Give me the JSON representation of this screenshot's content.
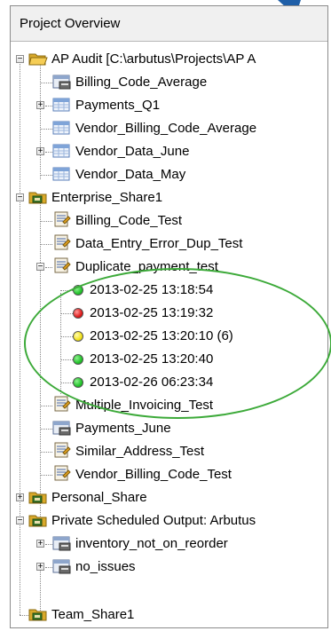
{
  "panel": {
    "title": "Project Overview"
  },
  "tree": [
    {
      "label": "AP Audit [C:\\arbutus\\Projects\\AP A",
      "icon": "folder-open-icon",
      "expander": "-"
    },
    {
      "label": "Billing_Code_Average",
      "icon": "table-layout-icon",
      "expander": ""
    },
    {
      "label": "Payments_Q1",
      "icon": "table-icon",
      "expander": "+"
    },
    {
      "label": "Vendor_Billing_Code_Average",
      "icon": "table-icon",
      "expander": ""
    },
    {
      "label": "Vendor_Data_June",
      "icon": "table-icon",
      "expander": "+"
    },
    {
      "label": "Vendor_Data_May",
      "icon": "table-icon",
      "expander": ""
    },
    {
      "label": "Enterprise_Share1",
      "icon": "share-folder-icon",
      "expander": "-"
    },
    {
      "label": "Billing_Code_Test",
      "icon": "script-icon",
      "expander": ""
    },
    {
      "label": "Data_Entry_Error_Dup_Test",
      "icon": "script-icon",
      "expander": ""
    },
    {
      "label": "Duplicate_payment_test",
      "icon": "script-icon",
      "expander": "-"
    },
    {
      "label": "2013-02-25 13:18:54",
      "status": "green",
      "expander": ""
    },
    {
      "label": "2013-02-25 13:19:32",
      "status": "red",
      "expander": ""
    },
    {
      "label": "2013-02-25 13:20:10 (6)",
      "status": "yellow",
      "expander": ""
    },
    {
      "label": "2013-02-25 13:20:40",
      "status": "green",
      "expander": ""
    },
    {
      "label": "2013-02-26 06:23:34",
      "status": "green",
      "expander": ""
    },
    {
      "label": "Multiple_Invoicing_Test",
      "icon": "script-icon",
      "expander": ""
    },
    {
      "label": "Payments_June",
      "icon": "table-layout-icon",
      "expander": ""
    },
    {
      "label": "Similar_Address_Test",
      "icon": "script-icon",
      "expander": ""
    },
    {
      "label": "Vendor_Billing_Code_Test",
      "icon": "script-icon",
      "expander": ""
    },
    {
      "label": "Personal_Share",
      "icon": "share-folder-icon",
      "expander": "+"
    },
    {
      "label": "Private Scheduled Output:  Arbutus",
      "icon": "share-folder-icon",
      "expander": "-"
    },
    {
      "label": "inventory_not_on_reorder",
      "icon": "table-layout-icon",
      "expander": "+"
    },
    {
      "label": "no_issues",
      "icon": "table-layout-icon",
      "expander": "+"
    },
    {
      "label": "Team_Share1",
      "icon": "share-folder-icon",
      "expander": ""
    }
  ],
  "colors": {
    "green": "#22c32a",
    "red": "#e01b1b",
    "yellow": "#f2e21a",
    "highlight_oval": "#3daa3a",
    "arrow": "#1f5fa8"
  }
}
